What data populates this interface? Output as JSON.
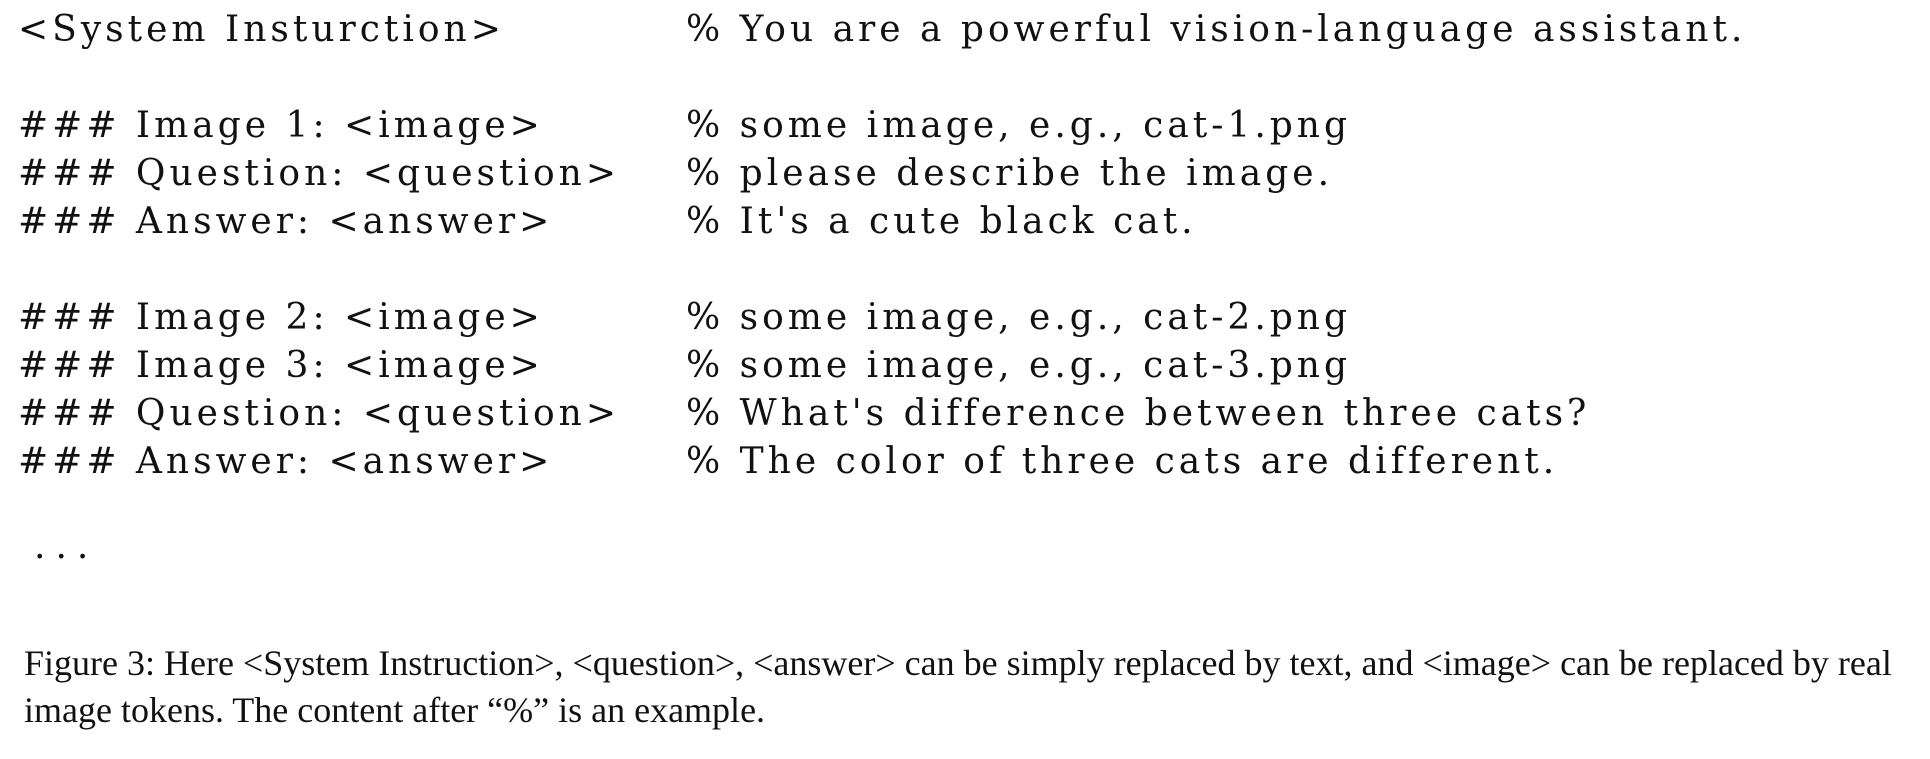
{
  "prompt": {
    "system": {
      "left": "<System Insturction>",
      "right": "% You are a powerful vision-language assistant."
    },
    "example1": [
      {
        "left": "### Image 1: <image>",
        "right": "% some image, e.g., cat-1.png"
      },
      {
        "left": "### Question: <question>",
        "right": "% please describe the image."
      },
      {
        "left": "### Answer: <answer>",
        "right": "% It's a cute black cat."
      }
    ],
    "example2": [
      {
        "left": "### Image 2: <image>",
        "right": "% some image, e.g., cat-2.png"
      },
      {
        "left": "### Image 3: <image>",
        "right": "% some image, e.g., cat-3.png"
      },
      {
        "left": "### Question: <question>",
        "right": "% What's difference between three cats?"
      },
      {
        "left": "### Answer: <answer>",
        "right": "% The color of three cats are different."
      }
    ],
    "ellipsis": "..."
  },
  "caption": {
    "text": "Figure 3: Here <System Instruction>, <question>, <answer> can be simply replaced by text, and <image> can be replaced by real image tokens. The content after “%” is an example."
  }
}
